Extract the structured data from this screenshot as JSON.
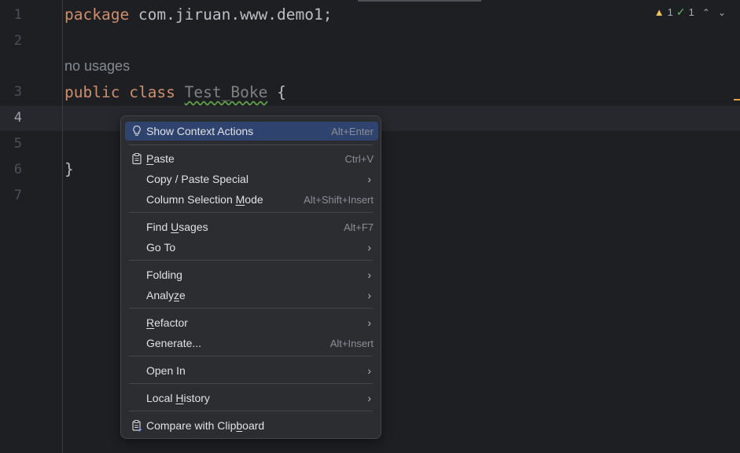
{
  "editor": {
    "line_numbers": [
      "1",
      "2",
      "3",
      "4",
      "5",
      "6",
      "7"
    ],
    "line1": {
      "kw": "package",
      "rest": " com.jiruan.www.demo1;"
    },
    "hint": "no usages",
    "line3": {
      "kw1": "public",
      "kw2": "class",
      "name": "Test_Boke",
      "brace": "{"
    },
    "line6": "}",
    "inspection": {
      "warnings": "1",
      "ok": "1"
    }
  },
  "menu": {
    "items": [
      {
        "label": "Show Context Actions",
        "shortcut": "Alt+Enter",
        "icon": "lightbulb-icon"
      },
      {
        "label_pre": "",
        "label_u": "P",
        "label_post": "aste",
        "shortcut": "Ctrl+V",
        "icon": "clipboard-icon"
      },
      {
        "label": "Copy / Paste Special",
        "submenu": "›"
      },
      {
        "label_pre": "Column Selection ",
        "label_u": "M",
        "label_post": "ode",
        "shortcut": "Alt+Shift+Insert"
      },
      {
        "label_pre": "Find ",
        "label_u": "U",
        "label_post": "sages",
        "shortcut": "Alt+F7"
      },
      {
        "label": "Go To",
        "submenu": "›"
      },
      {
        "label": "Folding",
        "submenu": "›"
      },
      {
        "label_pre": "Analy",
        "label_u": "z",
        "label_post": "e",
        "submenu": "›"
      },
      {
        "label_pre": "",
        "label_u": "R",
        "label_post": "efactor",
        "submenu": "›"
      },
      {
        "label": "Generate...",
        "shortcut": "Alt+Insert"
      },
      {
        "label": "Open In",
        "submenu": "›"
      },
      {
        "label_pre": "Local ",
        "label_u": "H",
        "label_post": "istory",
        "submenu": "›"
      },
      {
        "label_pre": "Compare with Clip",
        "label_u": "b",
        "label_post": "oard",
        "icon": "compare-clipboard-icon"
      }
    ]
  }
}
